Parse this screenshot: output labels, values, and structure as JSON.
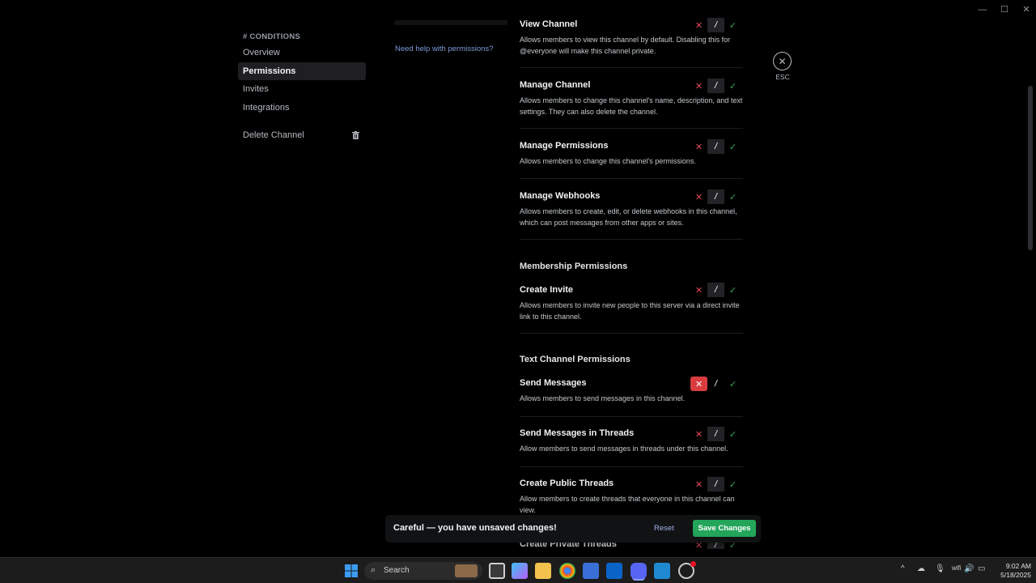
{
  "window": {
    "minimize": "—",
    "maximize": "☐",
    "close": "✕"
  },
  "sidebar": {
    "section_title": "# CONDITIONS",
    "items": [
      {
        "label": "Overview"
      },
      {
        "label": "Permissions"
      },
      {
        "label": "Invites"
      },
      {
        "label": "Integrations"
      },
      {
        "label": "Delete Channel"
      }
    ]
  },
  "main": {
    "help_link": "Need help with permissions?",
    "permissions": [
      {
        "title": "View Channel",
        "desc": "Allows members to view this channel by default. Disabling this for @everyone will make this channel private.",
        "state": "neutral"
      },
      {
        "title": "Manage Channel",
        "desc": "Allows members to change this channel's name, description, and text settings. They can also delete the channel.",
        "state": "neutral"
      },
      {
        "title": "Manage Permissions",
        "desc": "Allows members to change this channel's permissions.",
        "state": "neutral"
      },
      {
        "title": "Manage Webhooks",
        "desc": "Allows members to create, edit, or delete webhooks in this channel, which can post messages from other apps or sites.",
        "state": "neutral"
      },
      {
        "title": "Create Invite",
        "desc": "Allows members to invite new people to this server via a direct invite link to this channel.",
        "state": "neutral"
      },
      {
        "title": "Send Messages",
        "desc": "Allows members to send messages in this channel.",
        "state": "deny"
      },
      {
        "title": "Send Messages in Threads",
        "desc": "Allow members to send messages in threads under this channel.",
        "state": "neutral"
      },
      {
        "title": "Create Public Threads",
        "desc": "Allow members to create threads that everyone in this channel can view.",
        "state": "neutral"
      },
      {
        "title": "Create Private Threads",
        "desc": "",
        "state": "neutral"
      }
    ],
    "groups": {
      "membership": "Membership Permissions",
      "text": "Text Channel Permissions"
    },
    "toggle": {
      "deny": "✕",
      "neutral": "/",
      "allow": "✓"
    }
  },
  "esc": {
    "icon": "✕",
    "label": "ESC"
  },
  "notice": {
    "text": "Careful — you have unsaved changes!",
    "reset": "Reset",
    "save": "Save Changes"
  },
  "taskbar": {
    "search_label": "Search",
    "time": "9:02 AM",
    "date": "5/18/2025",
    "tray": {
      "chevron": "^",
      "cloud": "☁",
      "mic": "🎙",
      "wifi": "wifi",
      "volume": "🔊",
      "battery": "▭"
    }
  }
}
